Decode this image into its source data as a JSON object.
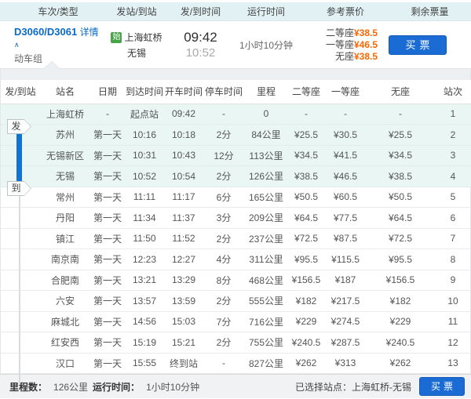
{
  "colors": {
    "accent_blue": "#1a6bd4",
    "link_blue": "#0b6ac8",
    "price_orange": "#ff6600",
    "start_badge_green": "#47a447",
    "header_bar_bg": "#e1f1f4",
    "highlight_row_bg": "#e9f6f4",
    "range_bar_blue": "#1273d2"
  },
  "top_header": {
    "columns": [
      "车次/类型",
      "发站/到站",
      "发/到时间",
      "运行时间",
      "参考票价",
      "剩余票量"
    ]
  },
  "icons": {
    "chevron_up": "∧"
  },
  "train": {
    "number": "D3060/D3061",
    "details_label": "详情",
    "type": "动车组",
    "start_badge": "始",
    "from_station": "上海虹桥",
    "to_station": "无锡",
    "depart_time": "09:42",
    "arrive_time": "10:52",
    "duration": "1小时10分钟",
    "prices": [
      {
        "label": "二等座",
        "value": "¥38.5"
      },
      {
        "label": "一等座",
        "value": "¥46.5"
      },
      {
        "label": "无座",
        "value": "¥38.5"
      }
    ],
    "buy_button": "买票"
  },
  "table": {
    "headers": [
      "发/到站",
      "站名",
      "日期",
      "到达时间",
      "开车时间",
      "停车时间",
      "里程",
      "二等座",
      "一等座",
      "无座",
      "站次"
    ],
    "depart_badge": "发",
    "arrive_badge": "到",
    "rows": [
      {
        "cells": [
          "上海虹桥",
          "-",
          "起点站",
          "09:42",
          "-",
          "0",
          "-",
          "-",
          "-",
          "1"
        ],
        "highlighted": true,
        "badge": "depart"
      },
      {
        "cells": [
          "苏州",
          "第一天",
          "10:16",
          "10:18",
          "2分",
          "84公里",
          "¥25.5",
          "¥30.5",
          "¥25.5",
          "2"
        ],
        "highlighted": true
      },
      {
        "cells": [
          "无锡新区",
          "第一天",
          "10:31",
          "10:43",
          "12分",
          "113公里",
          "¥34.5",
          "¥41.5",
          "¥34.5",
          "3"
        ],
        "highlighted": true
      },
      {
        "cells": [
          "无锡",
          "第一天",
          "10:52",
          "10:54",
          "2分",
          "126公里",
          "¥38.5",
          "¥46.5",
          "¥38.5",
          "4"
        ],
        "highlighted": true,
        "badge": "arrive"
      },
      {
        "cells": [
          "常州",
          "第一天",
          "11:11",
          "11:17",
          "6分",
          "165公里",
          "¥50.5",
          "¥60.5",
          "¥50.5",
          "5"
        ]
      },
      {
        "cells": [
          "丹阳",
          "第一天",
          "11:34",
          "11:37",
          "3分",
          "209公里",
          "¥64.5",
          "¥77.5",
          "¥64.5",
          "6"
        ]
      },
      {
        "cells": [
          "镇江",
          "第一天",
          "11:50",
          "11:52",
          "2分",
          "237公里",
          "¥72.5",
          "¥87.5",
          "¥72.5",
          "7"
        ]
      },
      {
        "cells": [
          "南京南",
          "第一天",
          "12:23",
          "12:27",
          "4分",
          "311公里",
          "¥95.5",
          "¥115.5",
          "¥95.5",
          "8"
        ]
      },
      {
        "cells": [
          "合肥南",
          "第一天",
          "13:21",
          "13:29",
          "8分",
          "468公里",
          "¥156.5",
          "¥187",
          "¥156.5",
          "9"
        ]
      },
      {
        "cells": [
          "六安",
          "第一天",
          "13:57",
          "13:59",
          "2分",
          "555公里",
          "¥182",
          "¥217.5",
          "¥182",
          "10"
        ]
      },
      {
        "cells": [
          "麻城北",
          "第一天",
          "14:56",
          "15:03",
          "7分",
          "716公里",
          "¥229",
          "¥274.5",
          "¥229",
          "11"
        ]
      },
      {
        "cells": [
          "红安西",
          "第一天",
          "15:19",
          "15:21",
          "2分",
          "755公里",
          "¥240.5",
          "¥287.5",
          "¥240.5",
          "12"
        ]
      },
      {
        "cells": [
          "汉口",
          "第一天",
          "15:55",
          "终到站",
          "-",
          "827公里",
          "¥262",
          "¥313",
          "¥262",
          "13"
        ]
      }
    ]
  },
  "footer": {
    "distance_label": "里程数：",
    "distance_value": "126公里",
    "duration_label": "运行时间：",
    "duration_value": "1小时10分钟",
    "selected_stations_label": "已选择站点：上海虹桥-无锡",
    "buy_button": "买票"
  }
}
